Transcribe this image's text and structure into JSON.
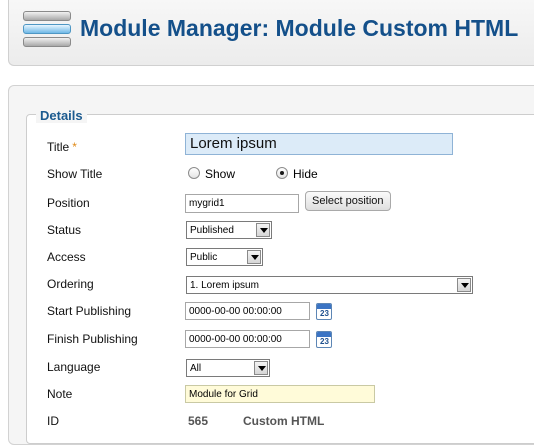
{
  "header": {
    "title": "Module Manager: Module Custom HTML",
    "icon": "module-manager-icon"
  },
  "details": {
    "legend": "Details",
    "title": {
      "label": "Title",
      "required_mark": "*",
      "value": "Lorem ipsum"
    },
    "show_title": {
      "label": "Show Title",
      "options": [
        "Show",
        "Hide"
      ],
      "selected": "Hide"
    },
    "position": {
      "label": "Position",
      "value": "mygrid1",
      "button": "Select position"
    },
    "status": {
      "label": "Status",
      "value": "Published"
    },
    "access": {
      "label": "Access",
      "value": "Public"
    },
    "ordering": {
      "label": "Ordering",
      "value": "1. Lorem ipsum"
    },
    "start_publishing": {
      "label": "Start Publishing",
      "value": "0000-00-00 00:00:00",
      "calendar_day": "23"
    },
    "finish_publishing": {
      "label": "Finish Publishing",
      "value": "0000-00-00 00:00:00",
      "calendar_day": "23"
    },
    "language": {
      "label": "Language",
      "value": "All"
    },
    "note": {
      "label": "Note",
      "value": "Module for Grid"
    },
    "id": {
      "label": "ID",
      "value": "565",
      "type": "Custom HTML"
    }
  },
  "colors": {
    "title": "#14508a",
    "legend": "#1b5a8f",
    "title_field_bg": "#dcebf8",
    "note_field_bg": "#fffbd9"
  }
}
